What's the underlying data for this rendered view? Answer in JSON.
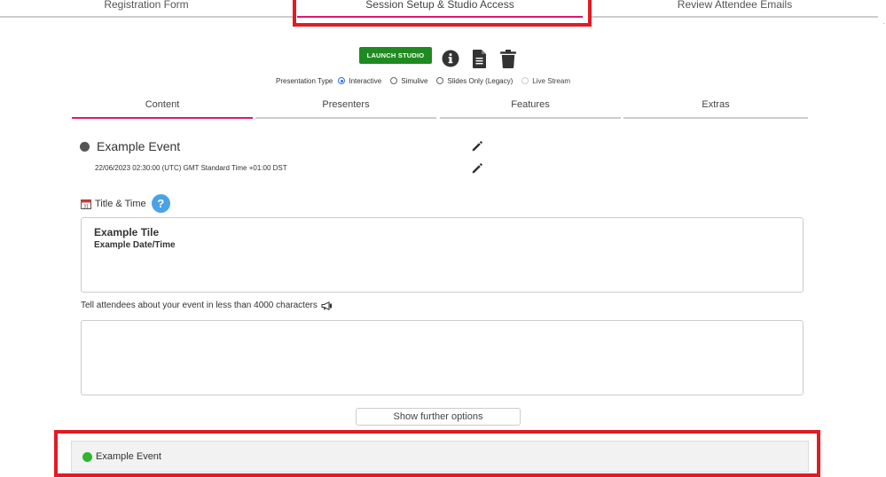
{
  "steps": [
    {
      "label": "Registration Form"
    },
    {
      "label": "Session Setup & Studio Access"
    },
    {
      "label": "Review Attendee Emails"
    }
  ],
  "toolbar": {
    "launch_label": "LAUNCH STUDIO",
    "launch_color": "#1f8a1f",
    "icons": [
      "info-icon",
      "document-icon",
      "trash-icon"
    ]
  },
  "presentation_type": {
    "label": "Presentation Type",
    "options": [
      {
        "label": "Interactive",
        "selected": true
      },
      {
        "label": "Simulive",
        "selected": false
      },
      {
        "label": "Slides Only (Legacy)",
        "selected": false
      },
      {
        "label": "Live Stream",
        "selected": false,
        "disabled": true
      }
    ]
  },
  "subtabs": [
    {
      "label": "Content",
      "active": true
    },
    {
      "label": "Presenters",
      "active": false
    },
    {
      "label": "Features",
      "active": false
    },
    {
      "label": "Extras",
      "active": false
    }
  ],
  "event": {
    "title": "Example Event",
    "status_color": "#555555",
    "datetime": "22/06/2023 02:30:00 (UTC) GMT Standard Time +01:00 DST"
  },
  "title_time": {
    "label": "Title & Time",
    "help_glyph": "?",
    "line1": "Example Tile",
    "line2": "Example Date/Time"
  },
  "description": {
    "label": "Tell attendees about your event in less than 4000 characters",
    "value": ""
  },
  "further_options_label": "Show further options",
  "bottom_bar": {
    "label": "Example Event",
    "status_color": "#2fb52f"
  },
  "colors": {
    "accent": "#e0176f",
    "highlight": "#e01b24",
    "help": "#4aa3e6"
  }
}
